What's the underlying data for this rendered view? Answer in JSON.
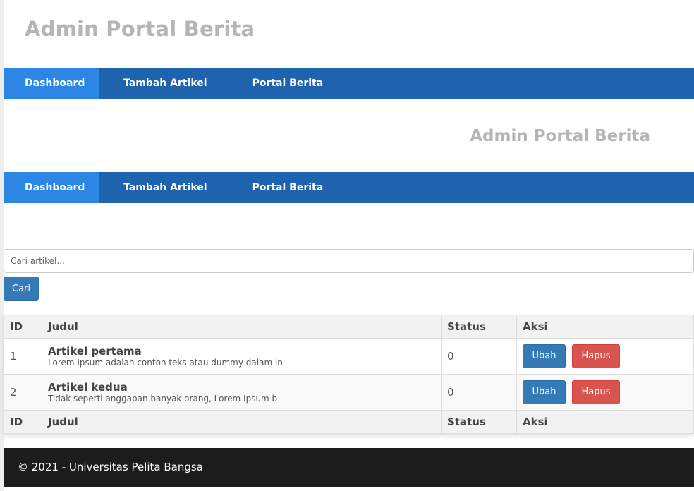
{
  "header": {
    "title": "Admin Portal Berita"
  },
  "nav": {
    "items": [
      {
        "label": "Dashboard"
      },
      {
        "label": "Tambah Artikel"
      },
      {
        "label": "Portal Berita"
      }
    ]
  },
  "subheader": {
    "title": "Admin Portal Berita"
  },
  "nav2": {
    "items": [
      {
        "label": "Dashboard"
      },
      {
        "label": "Tambah Artikel"
      },
      {
        "label": "Portal Berita"
      }
    ]
  },
  "search": {
    "placeholder": "Cari artikel...",
    "button_label": "Cari"
  },
  "table": {
    "headers": [
      "ID",
      "Judul",
      "Status",
      "Aksi"
    ],
    "rows": [
      {
        "id": "1",
        "title": "Artikel pertama",
        "desc": "Lorem Ipsum adalah contoh teks atau dummy dalam in",
        "status": "0",
        "edit_label": "Ubah",
        "delete_label": "Hapus"
      },
      {
        "id": "2",
        "title": "Artikel kedua",
        "desc": "Tidak seperti anggapan banyak orang, Lorem Ipsum b",
        "status": "0",
        "edit_label": "Ubah",
        "delete_label": "Hapus"
      }
    ],
    "footers": [
      "ID",
      "Judul",
      "Status",
      "Aksi"
    ]
  },
  "footer": {
    "text": "© 2021 - Universitas Pelita Bangsa"
  },
  "colors": {
    "nav_bg": "#1f62ad",
    "nav_active": "#2b86e6",
    "primary": "#337ab7",
    "danger": "#d9534f",
    "footer_bg": "#1c1c1c"
  }
}
